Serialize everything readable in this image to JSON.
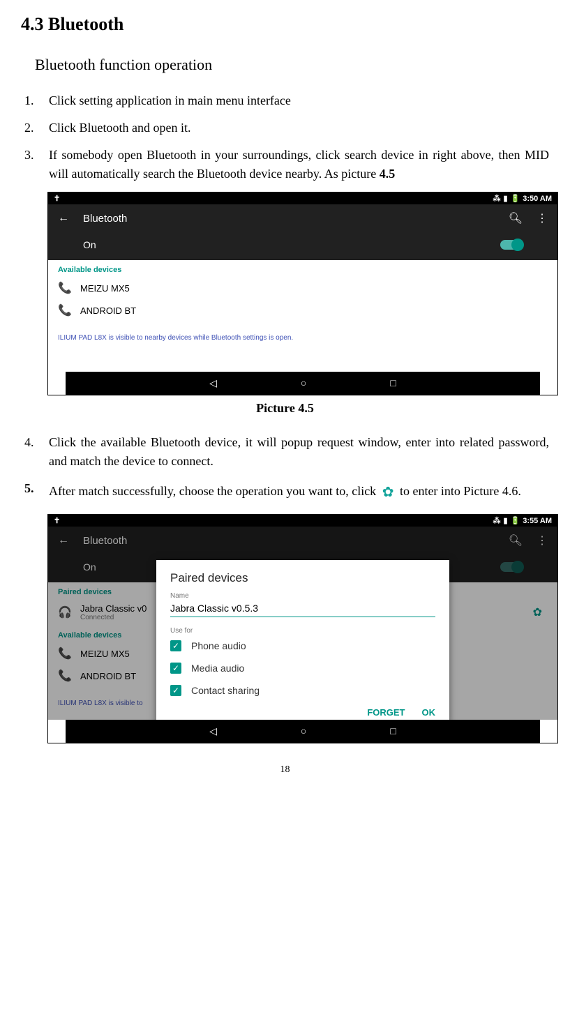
{
  "doc": {
    "section_heading": "4.3   Bluetooth",
    "sub_heading": "Bluetooth function operation",
    "steps": [
      {
        "num": "1.",
        "text": "Click setting application in main menu interface"
      },
      {
        "num": "2.",
        "text": "Click Bluetooth and open it."
      },
      {
        "num": "3.",
        "text_a": "If somebody open Bluetooth in your surroundings, click search device in right above, then MID will automatically search the Bluetooth device nearby. As picture ",
        "text_b": "4.5"
      },
      {
        "num": "4.",
        "text": "Click the available Bluetooth device, it will popup request window, enter into related password, and match the device to connect."
      },
      {
        "num": "5.",
        "text_a": "After match successfully, choose the operation you want to, click ",
        "text_b": " to enter into Picture 4.6."
      }
    ],
    "caption1": "Picture 4.5",
    "page_number": "18"
  },
  "shot1": {
    "status_time": "3:50 AM",
    "app_title": "Bluetooth",
    "toggle_label": "On",
    "available_label": "Available devices",
    "devices": [
      "MEIZU MX5",
      "ANDROID BT"
    ],
    "info": "ILIUM PAD L8X is visible to nearby devices while Bluetooth settings is open."
  },
  "shot2": {
    "status_time": "3:55 AM",
    "app_title": "Bluetooth",
    "toggle_label": "On",
    "paired_label": "Paired devices",
    "paired_device": "Jabra Classic v0",
    "paired_status": "Connected",
    "available_label": "Available devices",
    "devices": [
      "MEIZU MX5",
      "ANDROID BT"
    ],
    "info_partial": "ILIUM PAD L8X is visible to",
    "dialog": {
      "title": "Paired devices",
      "name_label": "Name",
      "name_value": "Jabra Classic v0.5.3",
      "use_for": "Use for",
      "opts": [
        "Phone audio",
        "Media audio",
        "Contact sharing"
      ],
      "forget": "FORGET",
      "ok": "OK"
    }
  }
}
